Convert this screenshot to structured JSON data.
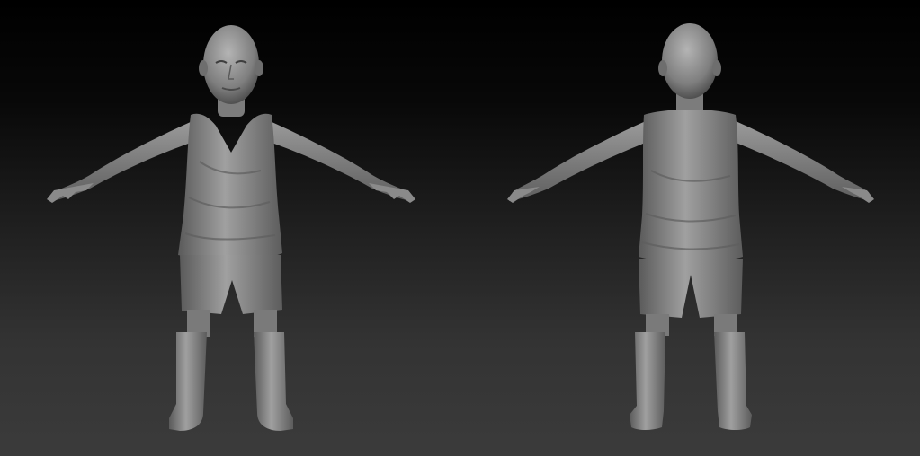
{
  "scene": {
    "background_top": "#000000",
    "background_bottom": "#3b3b3b",
    "clay_color": "#8c8c8c",
    "clay_shadow": "#4a4a4a",
    "clay_highlight": "#c4c4c4",
    "views": [
      {
        "id": "front",
        "facing": "front"
      },
      {
        "id": "back",
        "facing": "back"
      }
    ]
  }
}
